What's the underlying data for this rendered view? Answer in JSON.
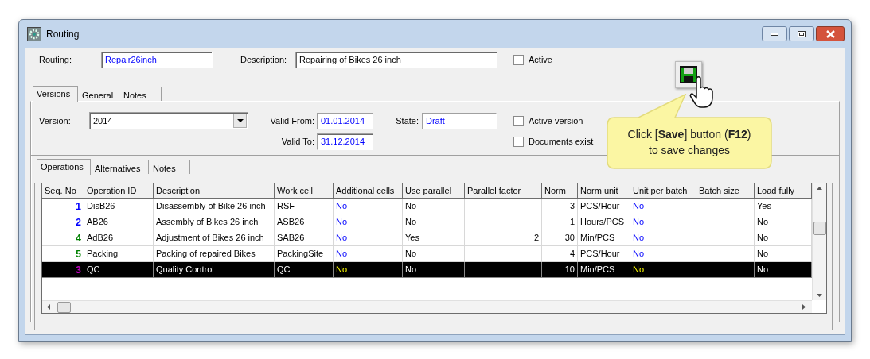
{
  "window": {
    "title": "Routing"
  },
  "header_fields": [
    {
      "label": "Routing:",
      "value": "Repair26inch",
      "kind": "lookup"
    },
    {
      "label": "Description:",
      "value": "Repairing of Bikes 26 inch",
      "kind": "text"
    }
  ],
  "header_checkbox": {
    "label": "Active",
    "checked": false
  },
  "tabs": [
    {
      "label": "Versions",
      "selected": true
    },
    {
      "label": "General",
      "selected": false
    },
    {
      "label": "Notes",
      "selected": false
    }
  ],
  "version": {
    "label": "Version:",
    "value": "2014"
  },
  "valid_from": {
    "label": "Valid From:",
    "value": "01.01.2014",
    "kind": "lookup"
  },
  "valid_to": {
    "label": "Valid To:",
    "value": "31.12.2014",
    "kind": "lookup"
  },
  "state": {
    "label": "State:",
    "value": "Draft",
    "kind": "lookup"
  },
  "version_checkboxes": [
    {
      "label": "Active version",
      "checked": false
    },
    {
      "label": "Documents exist",
      "checked": false
    }
  ],
  "inner_tabs": [
    {
      "label": "Operations",
      "selected": true
    },
    {
      "label": "Alternatives",
      "selected": false
    },
    {
      "label": "Notes",
      "selected": false
    }
  ],
  "table": {
    "columns": [
      {
        "label": "Seq. No",
        "kind": "seq"
      },
      {
        "label": "Operation ID",
        "kind": "text"
      },
      {
        "label": "Description",
        "kind": "text"
      },
      {
        "label": "Work cell",
        "kind": "text"
      },
      {
        "label": "Additional cells",
        "kind": "lookup"
      },
      {
        "label": "Use parallel",
        "kind": "text"
      },
      {
        "label": "Parallel factor",
        "kind": "number"
      },
      {
        "label": "Norm",
        "kind": "number"
      },
      {
        "label": "Norm unit",
        "kind": "text"
      },
      {
        "label": "Unit per batch",
        "kind": "lookup"
      },
      {
        "label": "Batch size",
        "kind": "number"
      },
      {
        "label": "Load fully",
        "kind": "text"
      }
    ],
    "rows": [
      {
        "selected": false,
        "color": "#0000ff",
        "cells": [
          "1",
          "DisB26",
          "Disassembly of Bike 26 inch",
          "RSF",
          "No",
          "No",
          "",
          "3",
          "PCS/Hour",
          "No",
          "",
          "Yes"
        ]
      },
      {
        "selected": false,
        "color": "#0000ff",
        "cells": [
          "2",
          "AB26",
          "Assembly of Bikes 26 inch",
          "ASB26",
          "No",
          "No",
          "",
          "1",
          "Hours/PCS",
          "No",
          "",
          "No"
        ]
      },
      {
        "selected": false,
        "color": "#008000",
        "cells": [
          "4",
          "AdB26",
          "Adjustment of Bikes 26 inch",
          "SAB26",
          "No",
          "Yes",
          "2",
          "30",
          "Min/PCS",
          "No",
          "",
          "No"
        ]
      },
      {
        "selected": false,
        "color": "#008000",
        "cells": [
          "5",
          "Packing",
          "Packing of repaired Bikes",
          "PackingSite",
          "No",
          "No",
          "",
          "4",
          "PCS/Hour",
          "No",
          "",
          "No"
        ]
      },
      {
        "selected": true,
        "color": "#c000c0",
        "cells": [
          "3",
          "QC",
          "Quality Control",
          "QC",
          "No",
          "No",
          "",
          "10",
          "Min/PCS",
          "No",
          "",
          "No"
        ]
      }
    ]
  },
  "callout": {
    "text": "Click [**Save**] button (**F12**) to save changes"
  }
}
